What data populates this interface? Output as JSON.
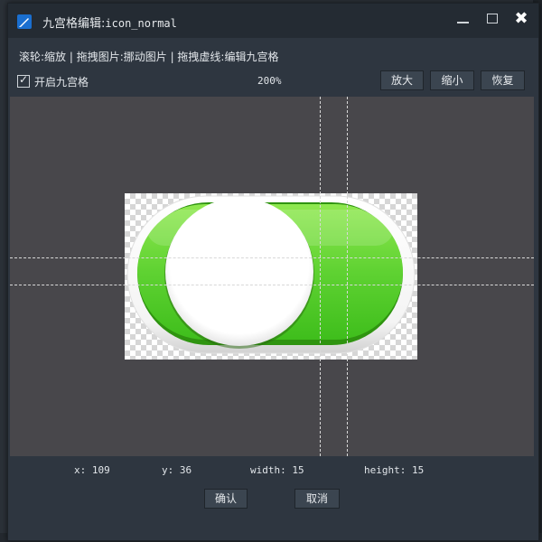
{
  "window": {
    "title_prefix": "九宫格编辑:",
    "title_name": "icon_normal",
    "minimize_icon": "minimize-icon",
    "maximize_icon": "maximize-icon",
    "close_icon": "close-icon",
    "close_glyph": "✖"
  },
  "hint": "滚轮:缩放 | 拖拽图片:挪动图片 | 拖拽虚线:编辑九宫格",
  "nine_grid_toggle": {
    "label": "开启九宫格",
    "checked": true,
    "check_glyph": "✓"
  },
  "zoom": "200%",
  "toolbar": {
    "zoom_in": "放大",
    "zoom_out": "缩小",
    "reset": "恢复"
  },
  "info": {
    "x_label": "x:",
    "x_value": "109",
    "y_label": "y:",
    "y_value": "36",
    "width_label": "width:",
    "width_value": "15",
    "height_label": "height:",
    "height_value": "15"
  },
  "actions": {
    "confirm": "确认",
    "cancel": "取消"
  },
  "colors": {
    "dialog_bg": "#2e3640",
    "titlebar_bg": "#242b33",
    "canvas_bg": "#48474b",
    "toggle_green": "#5fd232",
    "accent_blue": "#1a6fd0"
  }
}
